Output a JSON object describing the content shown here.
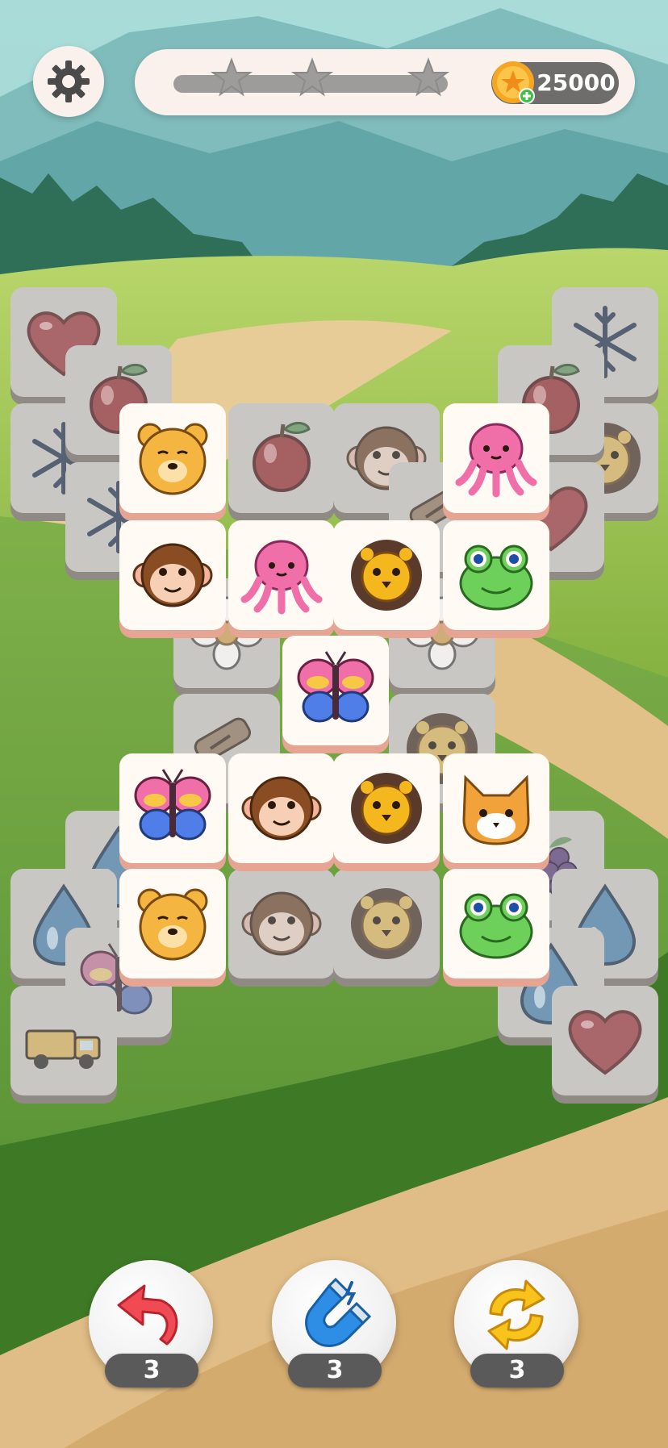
{
  "header": {
    "coins": "25000",
    "progress_fraction": 0.0,
    "stars_total": 3
  },
  "colors": {
    "pill_bg": "#fbf1ec",
    "tile_lit": "#fffaf4",
    "tile_dim": "#c9c7c4",
    "accent_coin": "#f5a623"
  },
  "boosters": [
    {
      "name": "undo",
      "icon": "undo-arrow-icon",
      "count": "3"
    },
    {
      "name": "magnet",
      "icon": "magnet-icon",
      "count": "3"
    },
    {
      "name": "shuffle",
      "icon": "shuffle-icon",
      "count": "3"
    }
  ],
  "board": {
    "tiles": [
      {
        "icon": "heart",
        "state": "covered"
      },
      {
        "icon": "snowflake",
        "state": "covered"
      },
      {
        "icon": "snowflake",
        "state": "covered"
      },
      {
        "icon": "snowflake",
        "state": "covered"
      },
      {
        "icon": "apple",
        "state": "covered"
      },
      {
        "icon": "monkey",
        "state": "covered"
      },
      {
        "icon": "lion",
        "state": "covered"
      },
      {
        "icon": "snowflake",
        "state": "covered"
      },
      {
        "icon": "apple",
        "state": "covered"
      },
      {
        "icon": "monkey",
        "state": "covered"
      },
      {
        "icon": "apple",
        "state": "covered"
      },
      {
        "icon": "bat",
        "state": "covered"
      },
      {
        "icon": "heart",
        "state": "covered"
      },
      {
        "icon": "flower",
        "state": "covered"
      },
      {
        "icon": "flower",
        "state": "covered"
      },
      {
        "icon": "bat",
        "state": "covered"
      },
      {
        "icon": "lion",
        "state": "covered"
      },
      {
        "icon": "drop",
        "state": "covered"
      },
      {
        "icon": "grapes",
        "state": "covered"
      },
      {
        "icon": "drop",
        "state": "covered"
      },
      {
        "icon": "drop",
        "state": "covered"
      },
      {
        "icon": "monkey",
        "state": "covered"
      },
      {
        "icon": "lion",
        "state": "covered"
      },
      {
        "icon": "butterfly",
        "state": "covered"
      },
      {
        "icon": "drop",
        "state": "covered"
      },
      {
        "icon": "truck",
        "state": "covered"
      },
      {
        "icon": "heart",
        "state": "covered"
      },
      {
        "icon": "bear",
        "state": "open"
      },
      {
        "icon": "octopus",
        "state": "open"
      },
      {
        "icon": "monkey",
        "state": "open"
      },
      {
        "icon": "octopus",
        "state": "open"
      },
      {
        "icon": "lion",
        "state": "open"
      },
      {
        "icon": "frog",
        "state": "open"
      },
      {
        "icon": "butterfly",
        "state": "open"
      },
      {
        "icon": "butterfly",
        "state": "open"
      },
      {
        "icon": "monkey",
        "state": "open"
      },
      {
        "icon": "lion",
        "state": "open"
      },
      {
        "icon": "cat",
        "state": "open"
      },
      {
        "icon": "bear",
        "state": "open"
      },
      {
        "icon": "frog",
        "state": "open"
      }
    ]
  }
}
